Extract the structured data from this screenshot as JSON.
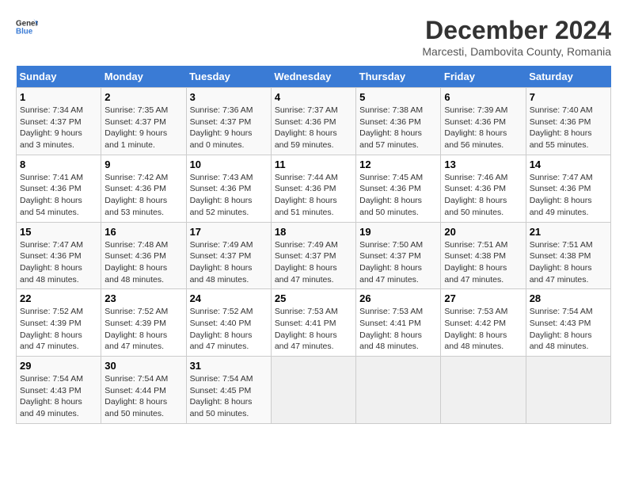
{
  "logo": {
    "text_general": "General",
    "text_blue": "Blue"
  },
  "title": "December 2024",
  "subtitle": "Marcesti, Dambovita County, Romania",
  "days_of_week": [
    "Sunday",
    "Monday",
    "Tuesday",
    "Wednesday",
    "Thursday",
    "Friday",
    "Saturday"
  ],
  "weeks": [
    [
      {
        "day": "1",
        "sunrise": "Sunrise: 7:34 AM",
        "sunset": "Sunset: 4:37 PM",
        "daylight": "Daylight: 9 hours and 3 minutes."
      },
      {
        "day": "2",
        "sunrise": "Sunrise: 7:35 AM",
        "sunset": "Sunset: 4:37 PM",
        "daylight": "Daylight: 9 hours and 1 minute."
      },
      {
        "day": "3",
        "sunrise": "Sunrise: 7:36 AM",
        "sunset": "Sunset: 4:37 PM",
        "daylight": "Daylight: 9 hours and 0 minutes."
      },
      {
        "day": "4",
        "sunrise": "Sunrise: 7:37 AM",
        "sunset": "Sunset: 4:36 PM",
        "daylight": "Daylight: 8 hours and 59 minutes."
      },
      {
        "day": "5",
        "sunrise": "Sunrise: 7:38 AM",
        "sunset": "Sunset: 4:36 PM",
        "daylight": "Daylight: 8 hours and 57 minutes."
      },
      {
        "day": "6",
        "sunrise": "Sunrise: 7:39 AM",
        "sunset": "Sunset: 4:36 PM",
        "daylight": "Daylight: 8 hours and 56 minutes."
      },
      {
        "day": "7",
        "sunrise": "Sunrise: 7:40 AM",
        "sunset": "Sunset: 4:36 PM",
        "daylight": "Daylight: 8 hours and 55 minutes."
      }
    ],
    [
      {
        "day": "8",
        "sunrise": "Sunrise: 7:41 AM",
        "sunset": "Sunset: 4:36 PM",
        "daylight": "Daylight: 8 hours and 54 minutes."
      },
      {
        "day": "9",
        "sunrise": "Sunrise: 7:42 AM",
        "sunset": "Sunset: 4:36 PM",
        "daylight": "Daylight: 8 hours and 53 minutes."
      },
      {
        "day": "10",
        "sunrise": "Sunrise: 7:43 AM",
        "sunset": "Sunset: 4:36 PM",
        "daylight": "Daylight: 8 hours and 52 minutes."
      },
      {
        "day": "11",
        "sunrise": "Sunrise: 7:44 AM",
        "sunset": "Sunset: 4:36 PM",
        "daylight": "Daylight: 8 hours and 51 minutes."
      },
      {
        "day": "12",
        "sunrise": "Sunrise: 7:45 AM",
        "sunset": "Sunset: 4:36 PM",
        "daylight": "Daylight: 8 hours and 50 minutes."
      },
      {
        "day": "13",
        "sunrise": "Sunrise: 7:46 AM",
        "sunset": "Sunset: 4:36 PM",
        "daylight": "Daylight: 8 hours and 50 minutes."
      },
      {
        "day": "14",
        "sunrise": "Sunrise: 7:47 AM",
        "sunset": "Sunset: 4:36 PM",
        "daylight": "Daylight: 8 hours and 49 minutes."
      }
    ],
    [
      {
        "day": "15",
        "sunrise": "Sunrise: 7:47 AM",
        "sunset": "Sunset: 4:36 PM",
        "daylight": "Daylight: 8 hours and 48 minutes."
      },
      {
        "day": "16",
        "sunrise": "Sunrise: 7:48 AM",
        "sunset": "Sunset: 4:36 PM",
        "daylight": "Daylight: 8 hours and 48 minutes."
      },
      {
        "day": "17",
        "sunrise": "Sunrise: 7:49 AM",
        "sunset": "Sunset: 4:37 PM",
        "daylight": "Daylight: 8 hours and 48 minutes."
      },
      {
        "day": "18",
        "sunrise": "Sunrise: 7:49 AM",
        "sunset": "Sunset: 4:37 PM",
        "daylight": "Daylight: 8 hours and 47 minutes."
      },
      {
        "day": "19",
        "sunrise": "Sunrise: 7:50 AM",
        "sunset": "Sunset: 4:37 PM",
        "daylight": "Daylight: 8 hours and 47 minutes."
      },
      {
        "day": "20",
        "sunrise": "Sunrise: 7:51 AM",
        "sunset": "Sunset: 4:38 PM",
        "daylight": "Daylight: 8 hours and 47 minutes."
      },
      {
        "day": "21",
        "sunrise": "Sunrise: 7:51 AM",
        "sunset": "Sunset: 4:38 PM",
        "daylight": "Daylight: 8 hours and 47 minutes."
      }
    ],
    [
      {
        "day": "22",
        "sunrise": "Sunrise: 7:52 AM",
        "sunset": "Sunset: 4:39 PM",
        "daylight": "Daylight: 8 hours and 47 minutes."
      },
      {
        "day": "23",
        "sunrise": "Sunrise: 7:52 AM",
        "sunset": "Sunset: 4:39 PM",
        "daylight": "Daylight: 8 hours and 47 minutes."
      },
      {
        "day": "24",
        "sunrise": "Sunrise: 7:52 AM",
        "sunset": "Sunset: 4:40 PM",
        "daylight": "Daylight: 8 hours and 47 minutes."
      },
      {
        "day": "25",
        "sunrise": "Sunrise: 7:53 AM",
        "sunset": "Sunset: 4:41 PM",
        "daylight": "Daylight: 8 hours and 47 minutes."
      },
      {
        "day": "26",
        "sunrise": "Sunrise: 7:53 AM",
        "sunset": "Sunset: 4:41 PM",
        "daylight": "Daylight: 8 hours and 48 minutes."
      },
      {
        "day": "27",
        "sunrise": "Sunrise: 7:53 AM",
        "sunset": "Sunset: 4:42 PM",
        "daylight": "Daylight: 8 hours and 48 minutes."
      },
      {
        "day": "28",
        "sunrise": "Sunrise: 7:54 AM",
        "sunset": "Sunset: 4:43 PM",
        "daylight": "Daylight: 8 hours and 48 minutes."
      }
    ],
    [
      {
        "day": "29",
        "sunrise": "Sunrise: 7:54 AM",
        "sunset": "Sunset: 4:43 PM",
        "daylight": "Daylight: 8 hours and 49 minutes."
      },
      {
        "day": "30",
        "sunrise": "Sunrise: 7:54 AM",
        "sunset": "Sunset: 4:44 PM",
        "daylight": "Daylight: 8 hours and 50 minutes."
      },
      {
        "day": "31",
        "sunrise": "Sunrise: 7:54 AM",
        "sunset": "Sunset: 4:45 PM",
        "daylight": "Daylight: 8 hours and 50 minutes."
      },
      null,
      null,
      null,
      null
    ]
  ]
}
